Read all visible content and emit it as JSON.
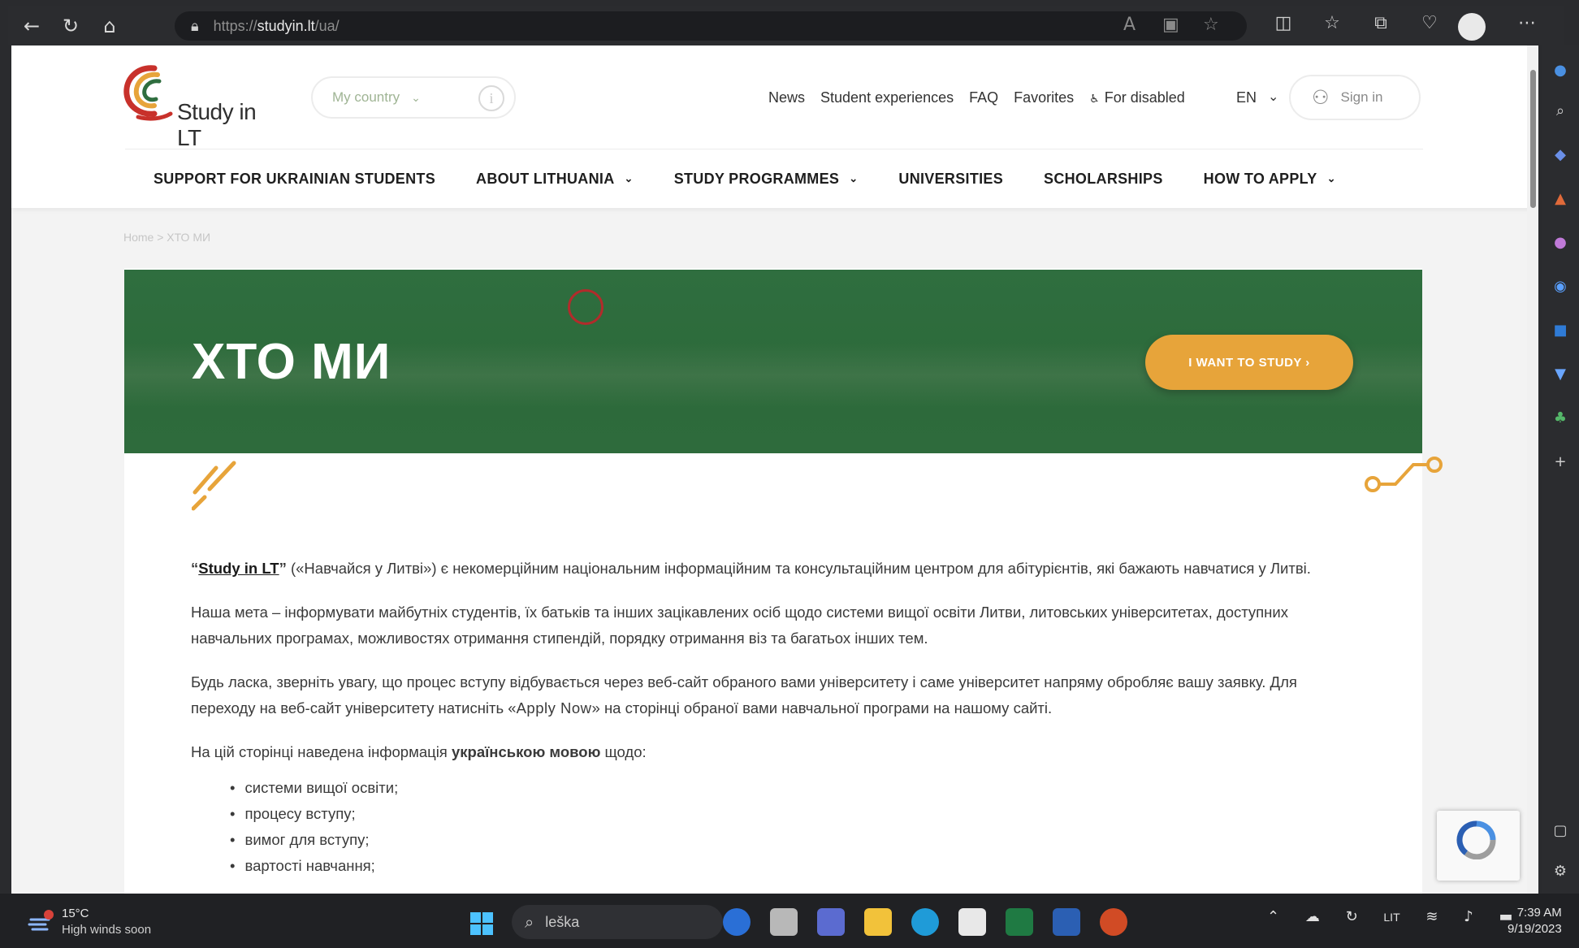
{
  "browser": {
    "url_prefix": "https://",
    "url_host": "studyin.lt",
    "url_path": "/ua/"
  },
  "header": {
    "logo_text": "Study in LT",
    "country_selector": "My country",
    "info_label": "i",
    "top_nav": [
      "News",
      "Student experiences",
      "FAQ",
      "Favorites",
      "For disabled"
    ],
    "language": "EN",
    "sign_in": "Sign in"
  },
  "main_nav": [
    {
      "label": "SUPPORT FOR UKRAINIAN STUDENTS",
      "dropdown": false
    },
    {
      "label": "ABOUT LITHUANIA",
      "dropdown": true
    },
    {
      "label": "STUDY PROGRAMMES",
      "dropdown": true
    },
    {
      "label": "UNIVERSITIES",
      "dropdown": false
    },
    {
      "label": "SCHOLARSHIPS",
      "dropdown": false
    },
    {
      "label": "HOW TO APPLY",
      "dropdown": true
    }
  ],
  "breadcrumb": "Home > ХТО МИ",
  "hero": {
    "title": "ХТО МИ",
    "cta": "I WANT TO STUDY  ›"
  },
  "article": {
    "p1_link": "Study in LT",
    "p1_open_quote": "“",
    "p1_close_quote": "”",
    "p1_rest": " («Навчайся у Литві») є некомерційним національним інформаційним та консультаційним центром для абітурієнтів, які бажають навчатися у Литві.",
    "p2": "Наша мета – інформувати майбутніх студентів, їх батьків та інших зацікавлених осіб щодо системи вищої освіти Литви, литовських університетах, доступних навчальних програмах, можливостях отримання стипендій, порядку отримання віз та багатьох інших тем.",
    "p3_before": "Будь ласка, зверніть увагу, що процес вступу відбувається через веб-сайт обраного вами університету і саме університет напряму обробляє вашу заявку. Для переходу на веб-сайт університету натисніть «",
    "p3_apply": "Apply Now",
    "p3_after": "» на сторінці обраної вами навчальної програми на нашому сайті.",
    "p4_before": "На цій сторінці наведена інформація ",
    "p4_bold": "українською мовою",
    "p4_after": " щодо:",
    "list": [
      "системи вищої освіти;",
      "процесу вступу;",
      "вимог для вступу;",
      "вартості навчання;"
    ]
  },
  "taskbar": {
    "weather_temp": "15°C",
    "weather_text": "High winds soon",
    "search": "leška",
    "lang": "LIT",
    "time": "7:39 AM",
    "date": "9/19/2023"
  },
  "colors": {
    "brand_green": "#2f6e3f",
    "cta_orange": "#e7a43a",
    "accent_red": "#b22b2b"
  }
}
